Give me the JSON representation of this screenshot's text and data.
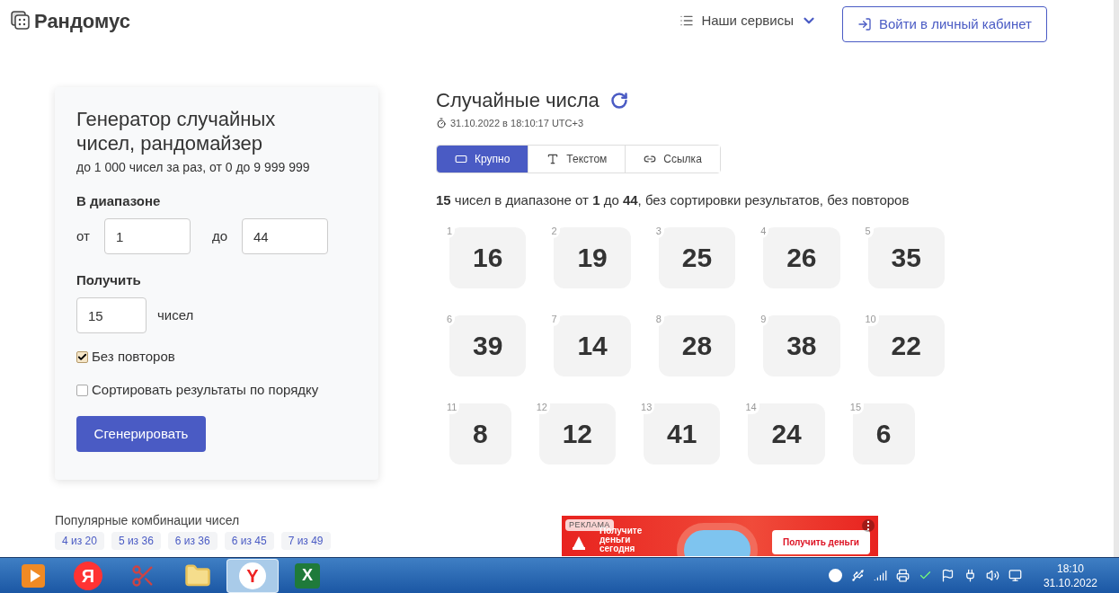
{
  "header": {
    "logo": "Рандомус",
    "services": "Наши сервисы",
    "login": "Войти в личный кабинет"
  },
  "form": {
    "title": "Генератор случайных чисел, рандомайзер",
    "subtitle": "до 1 000 чисел за раз, от 0 до 9 999 999",
    "range_label": "В диапазоне",
    "from_label": "от",
    "from_value": "1",
    "to_label": "до",
    "to_value": "44",
    "count_label": "Получить",
    "count_value": "15",
    "count_unit": "чисел",
    "options": [
      {
        "label": "Без повторов",
        "checked": true
      },
      {
        "label": "Сортировать результаты по порядку",
        "checked": false
      }
    ],
    "submit": "Сгенерировать"
  },
  "results": {
    "title": "Случайные числа",
    "timestamp": "31.10.2022 в 18:10:17 UTC+3",
    "tabs": [
      {
        "label": "Крупно",
        "kind": "large",
        "selected": true
      },
      {
        "label": "Текстом",
        "kind": "text",
        "selected": false
      },
      {
        "label": "Ссылка",
        "kind": "link",
        "selected": false
      }
    ],
    "summary": "**15** чисел в диапазоне от **1** до **44**, без сортировки результатов, без повторов",
    "numbers": [
      {
        "index": "1",
        "value": "16"
      },
      {
        "index": "2",
        "value": "19"
      },
      {
        "index": "3",
        "value": "25"
      },
      {
        "index": "4",
        "value": "26"
      },
      {
        "index": "5",
        "value": "35"
      },
      {
        "index": "6",
        "value": "39"
      },
      {
        "index": "7",
        "value": "14"
      },
      {
        "index": "8",
        "value": "28"
      },
      {
        "index": "9",
        "value": "38"
      },
      {
        "index": "10",
        "value": "22"
      },
      {
        "index": "11",
        "value": "8"
      },
      {
        "index": "12",
        "value": "12"
      },
      {
        "index": "13",
        "value": "41"
      },
      {
        "index": "14",
        "value": "24"
      },
      {
        "index": "15",
        "value": "6"
      }
    ]
  },
  "popular": {
    "title": "Популярные комбинации чисел",
    "items": [
      "4 из 20",
      "5 из 36",
      "6 из 36",
      "6 из 45",
      "7 из 49"
    ]
  },
  "ad": {
    "badge": "РЕКЛАМА",
    "headline": "Получите деньги сегодня",
    "button": "Получить деньги"
  },
  "taskbar": {
    "apps": [
      {
        "kind": "player",
        "selected": false
      },
      {
        "kind": "yandex",
        "label": "Я",
        "selected": false
      },
      {
        "kind": "scissors",
        "selected": false
      },
      {
        "kind": "folder",
        "selected": false
      },
      {
        "kind": "browser",
        "label": "Y",
        "selected": true
      },
      {
        "kind": "excel",
        "label": "X",
        "selected": false
      }
    ],
    "time": "18:10",
    "date": "31.10.2022"
  }
}
